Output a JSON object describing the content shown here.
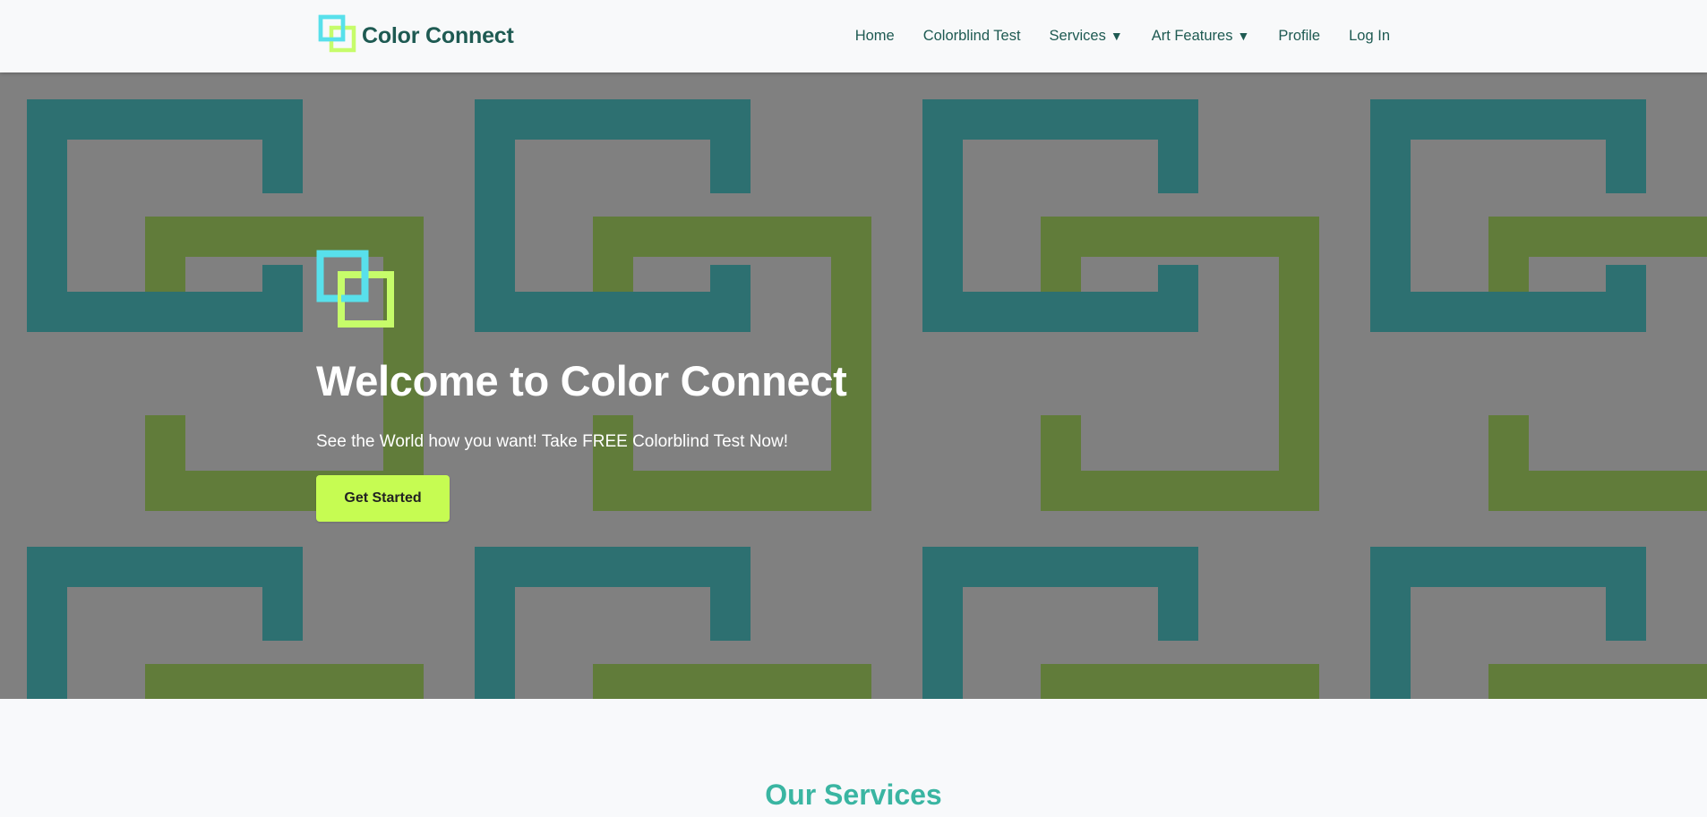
{
  "header": {
    "brand_name": "Color Connect",
    "nav": {
      "home": "Home",
      "colorblind_test": "Colorblind Test",
      "services": "Services",
      "art_features": "Art Features",
      "profile": "Profile",
      "login": "Log In"
    },
    "dropdown_caret": "▼"
  },
  "hero": {
    "title": "Welcome to Color Connect",
    "subtitle": "See the World how you want! Take FREE Colorblind Test Now!",
    "cta_label": "Get Started"
  },
  "services": {
    "heading": "Our Services"
  },
  "colors": {
    "brand_text": "#1e5a52",
    "logo_cyan": "#58e0eb",
    "logo_lime": "#c6fc6a",
    "hero_overlay": "#808080",
    "pattern_teal": "#2d7071",
    "pattern_green": "#617c3a",
    "cta_bg": "#c6fc52",
    "services_heading": "#3ab5a2"
  },
  "icons": {
    "brand_logo": "interlocking-squares-logo",
    "hero_logo": "interlocking-squares-logo",
    "dropdown": "caret-down"
  }
}
